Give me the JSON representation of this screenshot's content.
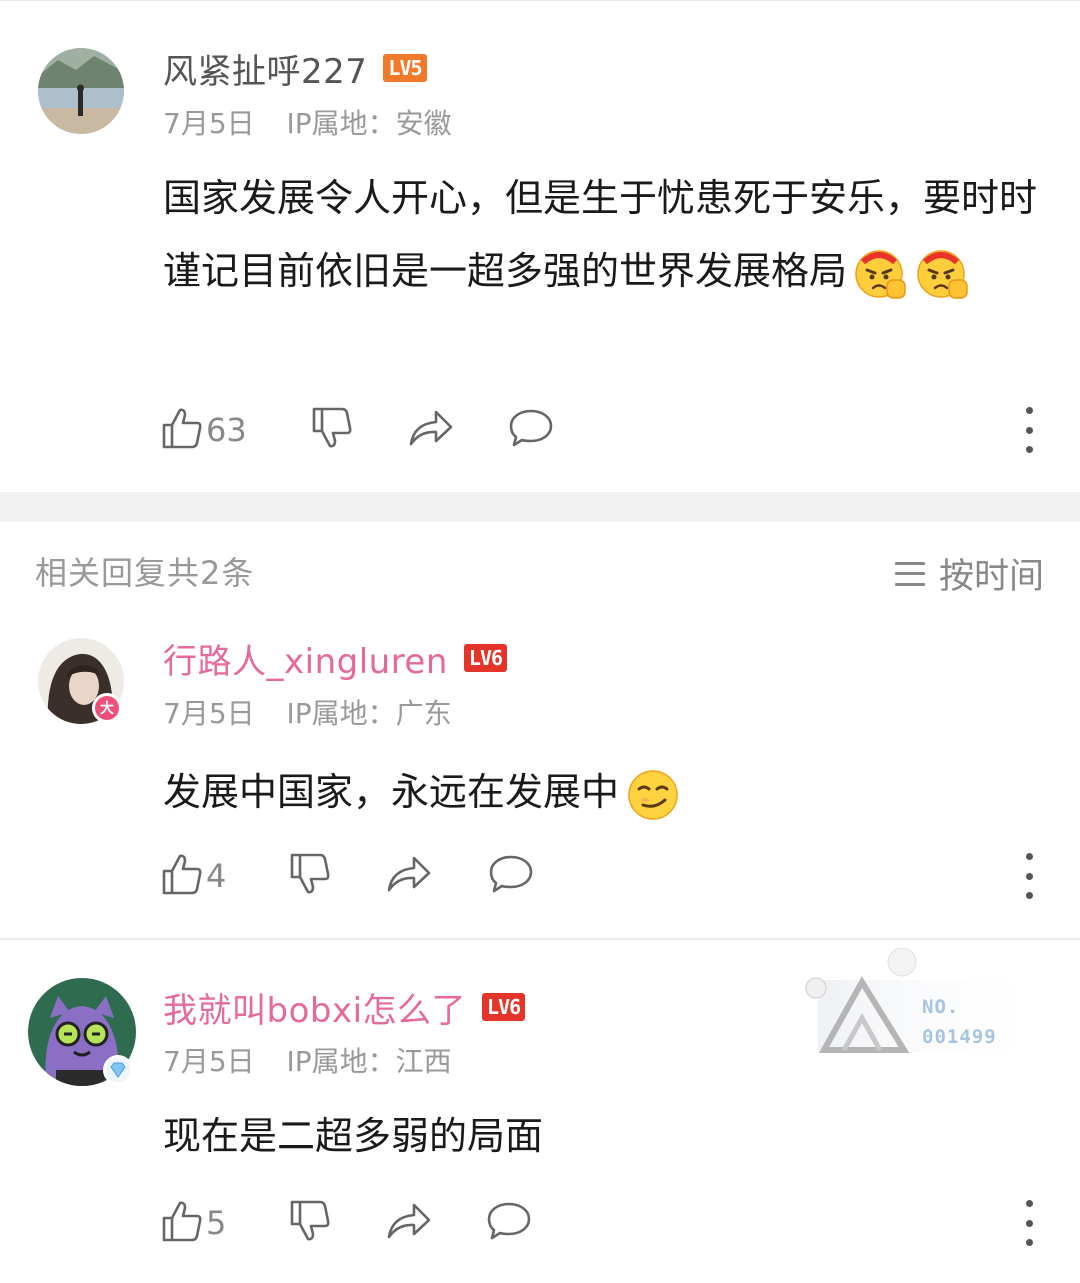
{
  "comment_main": {
    "username": "风紧扯呼227",
    "level": "LV5",
    "date": "7月5日",
    "ip_location": "IP属地：安徽",
    "text": "国家发展令人开心，但是生于忧患死于安乐，要时时谨记目前依旧是一超多强的世界发展格局",
    "emojis": [
      "angry-fist-emoji",
      "angry-fist-emoji"
    ],
    "likes": "63"
  },
  "replies_header": {
    "count_label": "相关回复共2条",
    "sort_label": "按时间"
  },
  "replies": [
    {
      "username": "行路人_xingluren",
      "level": "LV6",
      "badge": "大",
      "date": "7月5日",
      "ip_location": "IP属地：广东",
      "text": "发展中国家，永远在发展中",
      "emoji": "smirk-emoji",
      "likes": "4"
    },
    {
      "username": "我就叫bobxi怎么了",
      "level": "LV6",
      "date": "7月5日",
      "ip_location": "IP属地：江西",
      "text": "现在是二超多弱的局面",
      "likes": "5"
    }
  ],
  "medal": {
    "no_label": "NO.",
    "number": "001499"
  },
  "colors": {
    "pink_username": "#e56a9b",
    "lv5": "#f07a2a",
    "lv6": "#e5352b"
  }
}
